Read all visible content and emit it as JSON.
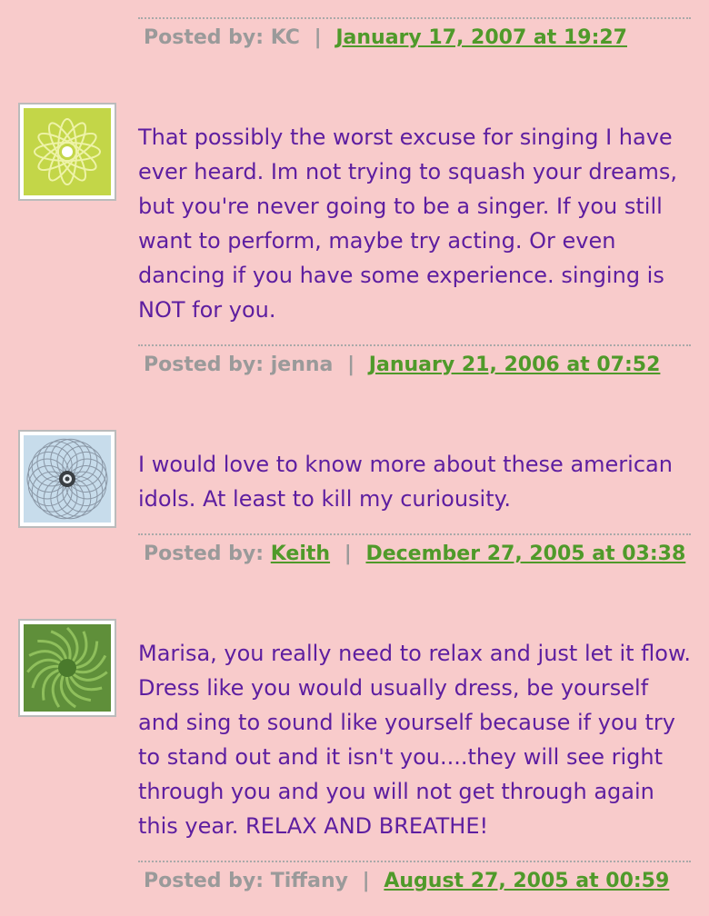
{
  "comments": [
    {
      "text": "",
      "posted_label": "Posted by:",
      "author": "KC",
      "author_linked": false,
      "date": "January 17, 2007 at 19:27"
    },
    {
      "text": "That possibly the worst excuse for singing I have ever heard. Im not trying to squash your dreams, but you're never going to be a singer. If you still want to perform, maybe try acting. Or even dancing if you have some experience. singing is NOT for you.",
      "posted_label": "Posted by:",
      "author": "jenna",
      "author_linked": false,
      "date": "January 21, 2006 at 07:52",
      "avatar_icon": "green-flower-avatar-icon"
    },
    {
      "text": "I would love to know more about these american idols. At least to kill my curiousity.",
      "posted_label": "Posted by:",
      "author": "Keith",
      "author_linked": true,
      "date": "December 27, 2005 at 03:38",
      "avatar_icon": "spirograph-avatar-icon"
    },
    {
      "text": "Marisa, you really need to relax and just let it flow. Dress like you would usually dress, be yourself and sing to sound like yourself because if you try to stand out and it isn't you....they will see right through you and you will not get through again this year. RELAX AND BREATHE!",
      "posted_label": "Posted by:",
      "author": "Tiffany",
      "author_linked": false,
      "date": "August 27, 2005 at 00:59",
      "avatar_icon": "green-swirl-avatar-icon"
    }
  ],
  "separator": "|",
  "colors": {
    "background": "#f8cbcb",
    "comment_text": "#5d1ea0",
    "meta_text": "#9a9a9a",
    "link": "#4f9a2a"
  }
}
